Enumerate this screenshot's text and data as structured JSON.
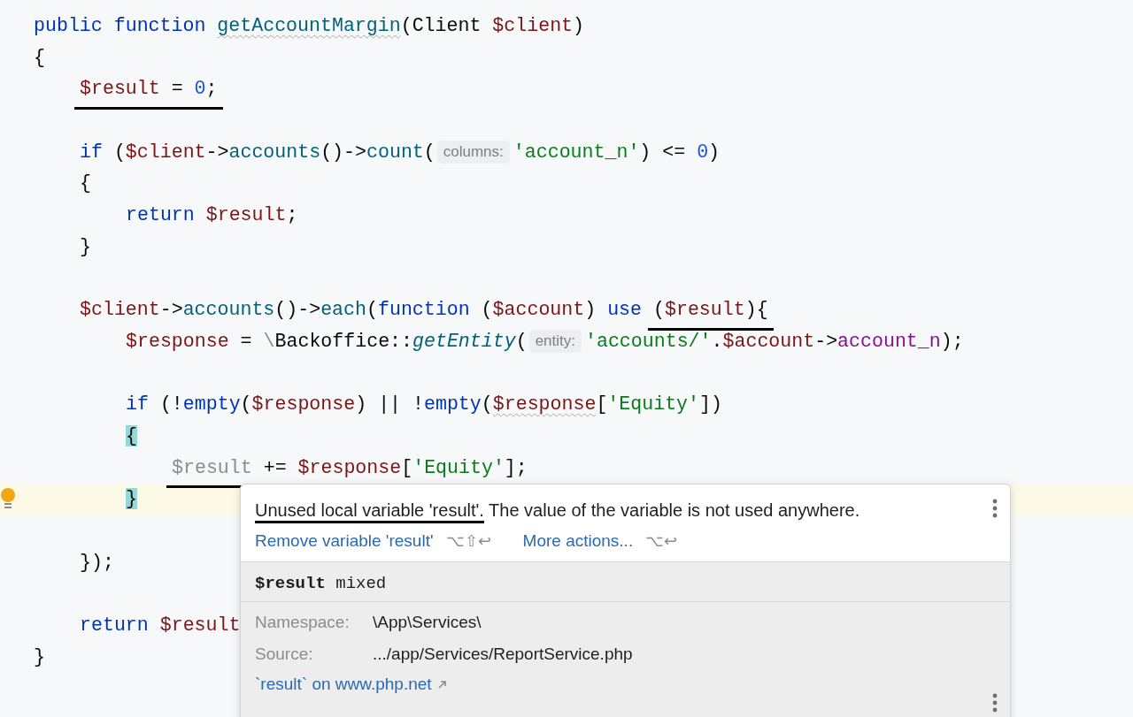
{
  "editor": {
    "lines": [
      {
        "kind": "code",
        "tokens": [
          {
            "kind": "keyword",
            "text": "public function "
          },
          {
            "kind": "func",
            "text": "getAccountMargin",
            "wavy": true
          },
          {
            "kind": "plain",
            "text": "(Client "
          },
          {
            "kind": "var",
            "text": "$client"
          },
          {
            "kind": "plain",
            "text": ")"
          }
        ]
      },
      {
        "kind": "code",
        "tokens": [
          {
            "kind": "plain",
            "text": "{"
          }
        ],
        "children": [
          {
            "kind": "code",
            "tokens": [
              {
                "kind": "var",
                "text": "$result",
                "underlined": true
              },
              {
                "kind": "plain",
                "text": " = ",
                "underlined": true
              },
              {
                "kind": "number",
                "text": "0",
                "underlined": true
              },
              {
                "kind": "plain",
                "text": ";",
                "underlined": true
              }
            ]
          },
          {
            "kind": "blank"
          },
          {
            "kind": "code",
            "tokens": [
              {
                "kind": "keyword",
                "text": "if"
              },
              {
                "kind": "plain",
                "text": " ("
              },
              {
                "kind": "var",
                "text": "$client"
              },
              {
                "kind": "plain",
                "text": "->"
              },
              {
                "kind": "func",
                "text": "accounts"
              },
              {
                "kind": "plain",
                "text": "()->"
              },
              {
                "kind": "func",
                "text": "count"
              },
              {
                "kind": "plain",
                "text": "("
              },
              {
                "kind": "hint",
                "text": "columns:"
              },
              {
                "kind": "string",
                "text": "'account_n'"
              },
              {
                "kind": "plain",
                "text": ") <= "
              },
              {
                "kind": "number",
                "text": "0"
              },
              {
                "kind": "plain",
                "text": ")"
              }
            ]
          },
          {
            "kind": "code",
            "tokens": [
              {
                "kind": "plain",
                "text": "{"
              }
            ],
            "children": [
              {
                "kind": "code",
                "tokens": [
                  {
                    "kind": "keyword",
                    "text": "return "
                  },
                  {
                    "kind": "var",
                    "text": "$result"
                  },
                  {
                    "kind": "plain",
                    "text": ";"
                  }
                ]
              }
            ]
          },
          {
            "kind": "code",
            "tokens": [
              {
                "kind": "plain",
                "text": "}"
              }
            ]
          },
          {
            "kind": "blank"
          },
          {
            "kind": "code",
            "tokens": [
              {
                "kind": "var",
                "text": "$client"
              },
              {
                "kind": "plain",
                "text": "->"
              },
              {
                "kind": "func",
                "text": "accounts"
              },
              {
                "kind": "plain",
                "text": "()->"
              },
              {
                "kind": "func",
                "text": "each"
              },
              {
                "kind": "plain",
                "text": "("
              },
              {
                "kind": "keyword",
                "text": "function"
              },
              {
                "kind": "plain",
                "text": " ("
              },
              {
                "kind": "var",
                "text": "$account"
              },
              {
                "kind": "plain",
                "text": ") "
              },
              {
                "kind": "keyword",
                "text": "use "
              },
              {
                "kind": "plain",
                "text": "(",
                "underlined": true
              },
              {
                "kind": "var",
                "text": "$result",
                "underlined": true
              },
              {
                "kind": "plain",
                "text": "){",
                "underlined": true
              }
            ],
            "children": [
              {
                "kind": "code",
                "tokens": [
                  {
                    "kind": "var",
                    "text": "$response"
                  },
                  {
                    "kind": "plain",
                    "text": " = "
                  },
                  {
                    "kind": "ns",
                    "text": "\\"
                  },
                  {
                    "kind": "plain",
                    "text": "Backoffice::"
                  },
                  {
                    "kind": "static",
                    "text": "getEntity"
                  },
                  {
                    "kind": "plain",
                    "text": "("
                  },
                  {
                    "kind": "hint",
                    "text": "entity:"
                  },
                  {
                    "kind": "string",
                    "text": "'accounts/'"
                  },
                  {
                    "kind": "plain",
                    "text": "."
                  },
                  {
                    "kind": "var",
                    "text": "$account"
                  },
                  {
                    "kind": "plain",
                    "text": "->"
                  },
                  {
                    "kind": "field",
                    "text": "account_n"
                  },
                  {
                    "kind": "plain",
                    "text": ");"
                  }
                ]
              },
              {
                "kind": "blank"
              },
              {
                "kind": "code",
                "tokens": [
                  {
                    "kind": "keyword",
                    "text": "if"
                  },
                  {
                    "kind": "plain",
                    "text": " (!"
                  },
                  {
                    "kind": "keyword",
                    "text": "empty"
                  },
                  {
                    "kind": "plain",
                    "text": "("
                  },
                  {
                    "kind": "var",
                    "text": "$response"
                  },
                  {
                    "kind": "plain",
                    "text": ") || !"
                  },
                  {
                    "kind": "keyword",
                    "text": "empty"
                  },
                  {
                    "kind": "plain",
                    "text": "("
                  },
                  {
                    "kind": "var",
                    "text": "$response",
                    "wavy": true
                  },
                  {
                    "kind": "plain",
                    "text": "["
                  },
                  {
                    "kind": "string",
                    "text": "'Equity'"
                  },
                  {
                    "kind": "plain",
                    "text": "])"
                  }
                ]
              },
              {
                "kind": "code",
                "tokens": [
                  {
                    "kind": "brace",
                    "text": "{",
                    "matched": true
                  }
                ],
                "children": [
                  {
                    "kind": "code",
                    "tokens": [
                      {
                        "kind": "unused",
                        "text": "$result",
                        "underlined": true
                      },
                      {
                        "kind": "plain",
                        "text": " += "
                      },
                      {
                        "kind": "var",
                        "text": "$response"
                      },
                      {
                        "kind": "plain",
                        "text": "["
                      },
                      {
                        "kind": "string",
                        "text": "'Equity'"
                      },
                      {
                        "kind": "plain",
                        "text": "];"
                      }
                    ]
                  }
                ]
              },
              {
                "kind": "code",
                "current": true,
                "bulb": true,
                "tokens": [
                  {
                    "kind": "brace",
                    "text": "}",
                    "matched": true
                  }
                ]
              },
              {
                "kind": "blank"
              }
            ]
          },
          {
            "kind": "code",
            "tokens": [
              {
                "kind": "plain",
                "text": "});"
              }
            ]
          },
          {
            "kind": "blank"
          },
          {
            "kind": "code",
            "tokens": [
              {
                "kind": "keyword",
                "text": "return "
              },
              {
                "kind": "var",
                "text": "$result"
              }
            ]
          }
        ]
      },
      {
        "kind": "code",
        "tokens": [
          {
            "kind": "plain",
            "text": "}"
          }
        ]
      }
    ]
  },
  "popup": {
    "message": {
      "marked": "Unused local variable 'result'.",
      "text": " The value of the variable is not used anywhere."
    },
    "actions": [
      {
        "label": "Remove variable 'result'",
        "shortcut": "⌥⇧↩"
      },
      {
        "label": "More actions...",
        "shortcut": "⌥↩"
      }
    ],
    "signature": {
      "name": "$result",
      "type": "mixed"
    },
    "details": [
      {
        "label": "Namespace:",
        "value": "\\App\\Services\\"
      },
      {
        "label": "Source:",
        "value": ".../app/Services/ReportService.php"
      }
    ],
    "doc_link": "`result` on www.php.net"
  }
}
